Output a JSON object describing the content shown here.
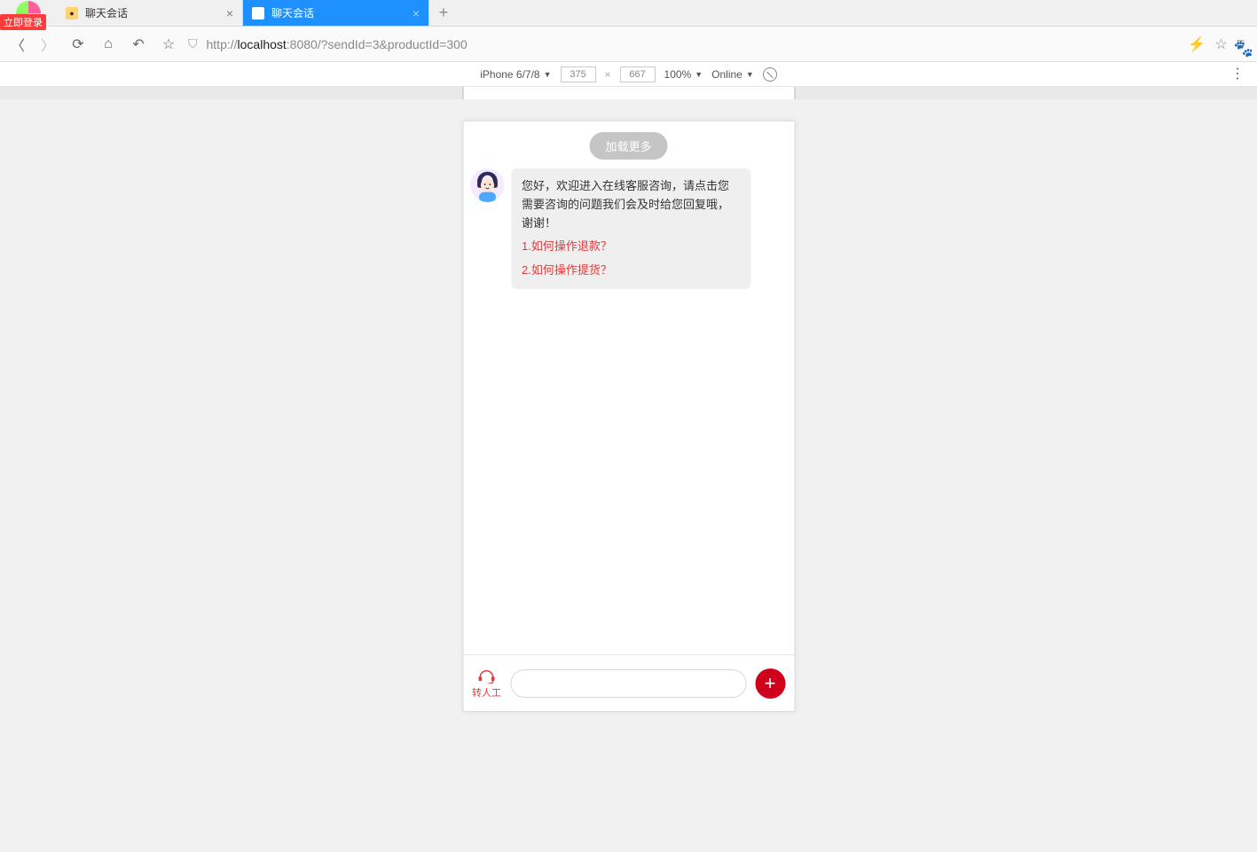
{
  "tabs": {
    "login_badge": "立即登录",
    "t0_title": "聊天会话",
    "t1_title": "聊天会话"
  },
  "address": {
    "prefix": "http://",
    "host": "localhost",
    "rest": ":8080/?sendId=3&productId=300"
  },
  "device_bar": {
    "device": "iPhone 6/7/8",
    "width": "375",
    "height": "667",
    "zoom": "100%",
    "network": "Online"
  },
  "chat": {
    "load_more": "加载更多",
    "welcome": "您好，欢迎进入在线客服咨询，请点击您需要咨询的问题我们会及时给您回复哦，谢谢！",
    "faq1": "1.如何操作退款？",
    "faq2": "2.如何操作提货？",
    "to_agent": "转人工",
    "input_placeholder": ""
  }
}
